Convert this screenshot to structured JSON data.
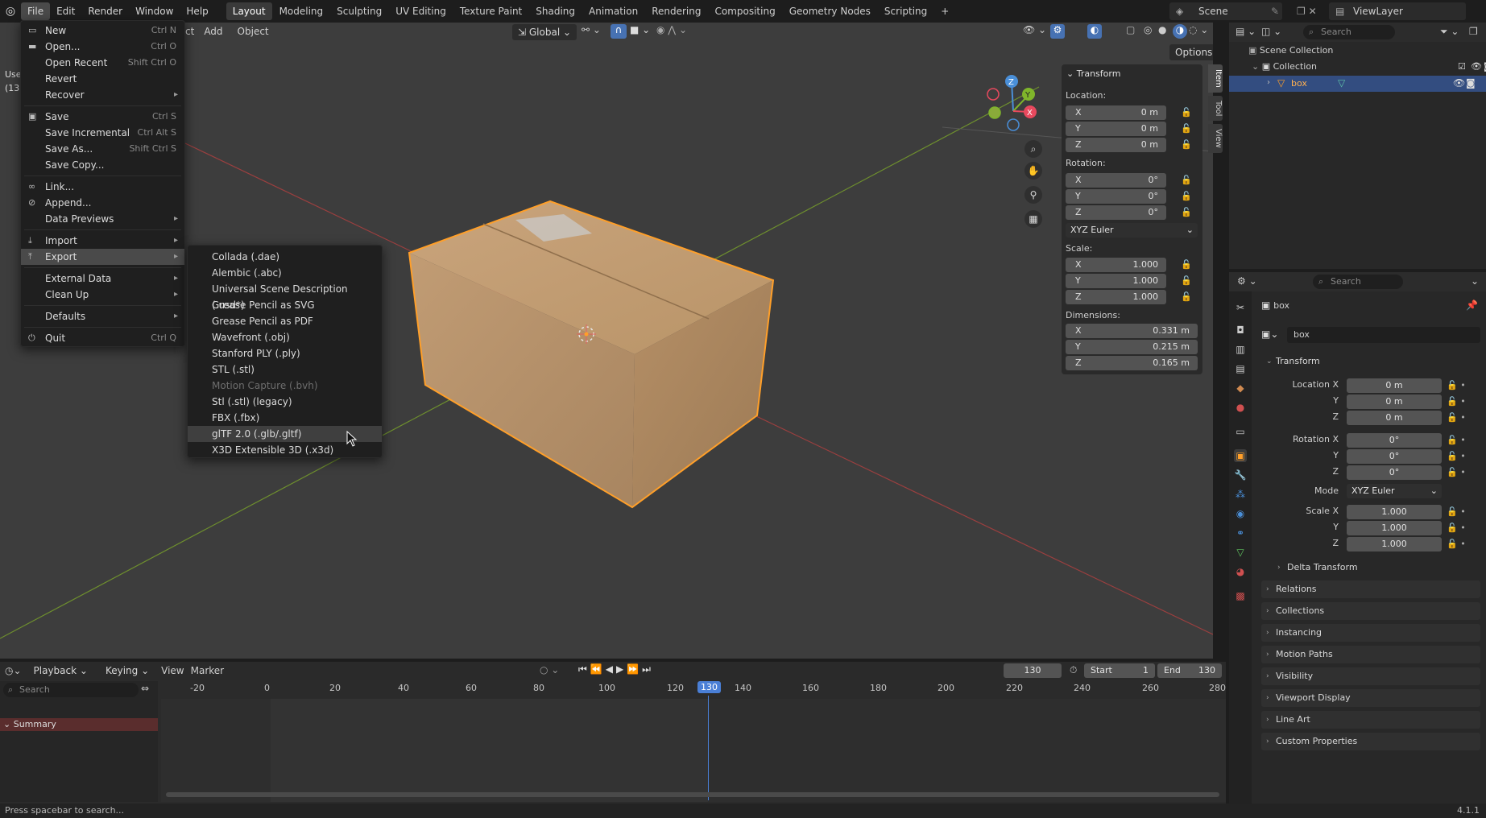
{
  "topbar": {
    "menus": [
      "File",
      "Edit",
      "Render",
      "Window",
      "Help"
    ],
    "workspaces": [
      "Layout",
      "Modeling",
      "Sculpting",
      "UV Editing",
      "Texture Paint",
      "Shading",
      "Animation",
      "Rendering",
      "Compositing",
      "Geometry Nodes",
      "Scripting"
    ],
    "add_tab": "+",
    "scene": "Scene",
    "view_layer": "ViewLayer"
  },
  "viewport_header": {
    "mode_partial": "ct",
    "add": "Add",
    "object": "Object",
    "orientation": "Global",
    "options": "Options",
    "side_text_1": "Use",
    "side_text_2": "(13"
  },
  "file_menu": {
    "items": [
      {
        "label": "New",
        "shortcut": "Ctrl N",
        "arrow": "▸"
      },
      {
        "label": "Open...",
        "shortcut": "Ctrl O"
      },
      {
        "label": "Open Recent",
        "shortcut": "Shift Ctrl O",
        "arrow": "▸"
      },
      {
        "label": "Revert"
      },
      {
        "label": "Recover",
        "arrow": "▸"
      },
      {
        "label": "Save",
        "shortcut": "Ctrl S"
      },
      {
        "label": "Save Incremental",
        "shortcut": "Ctrl Alt S"
      },
      {
        "label": "Save As...",
        "shortcut": "Shift Ctrl S"
      },
      {
        "label": "Save Copy..."
      },
      {
        "label": "Link..."
      },
      {
        "label": "Append..."
      },
      {
        "label": "Data Previews",
        "arrow": "▸"
      },
      {
        "label": "Import",
        "arrow": "▸"
      },
      {
        "label": "Export",
        "arrow": "▸"
      },
      {
        "label": "External Data",
        "arrow": "▸"
      },
      {
        "label": "Clean Up",
        "arrow": "▸"
      },
      {
        "label": "Defaults",
        "arrow": "▸"
      },
      {
        "label": "Quit",
        "shortcut": "Ctrl Q"
      }
    ]
  },
  "export_menu": {
    "items": [
      {
        "label": "Collada (.dae)",
        "state": "normal"
      },
      {
        "label": "Alembic (.abc)",
        "state": "normal"
      },
      {
        "label": "Universal Scene Description (.usd*)",
        "state": "normal"
      },
      {
        "label": "Grease Pencil as SVG",
        "state": "normal"
      },
      {
        "label": "Grease Pencil as PDF",
        "state": "normal"
      },
      {
        "label": "Wavefront (.obj)",
        "state": "normal"
      },
      {
        "label": "Stanford PLY (.ply)",
        "state": "normal"
      },
      {
        "label": "STL (.stl)",
        "state": "normal"
      },
      {
        "label": "Motion Capture (.bvh)",
        "state": "disabled"
      },
      {
        "label": "Stl (.stl) (legacy)",
        "state": "normal"
      },
      {
        "label": "FBX (.fbx)",
        "state": "normal"
      },
      {
        "label": "glTF 2.0 (.glb/.gltf)",
        "state": "highlighted"
      },
      {
        "label": "X3D Extensible 3D (.x3d)",
        "state": "normal"
      }
    ]
  },
  "npanel": {
    "title": "Transform",
    "location_label": "Location:",
    "location": [
      {
        "axis": "X",
        "value": "0 m"
      },
      {
        "axis": "Y",
        "value": "0 m"
      },
      {
        "axis": "Z",
        "value": "0 m"
      }
    ],
    "rotation_label": "Rotation:",
    "rotation": [
      {
        "axis": "X",
        "value": "0°"
      },
      {
        "axis": "Y",
        "value": "0°"
      },
      {
        "axis": "Z",
        "value": "0°"
      }
    ],
    "rotation_mode": "XYZ Euler",
    "scale_label": "Scale:",
    "scale": [
      {
        "axis": "X",
        "value": "1.000"
      },
      {
        "axis": "Y",
        "value": "1.000"
      },
      {
        "axis": "Z",
        "value": "1.000"
      }
    ],
    "dimensions_label": "Dimensions:",
    "dimensions": [
      {
        "axis": "X",
        "value": "0.331 m"
      },
      {
        "axis": "Y",
        "value": "0.215 m"
      },
      {
        "axis": "Z",
        "value": "0.165 m"
      }
    ],
    "tabs": [
      "Item",
      "Tool",
      "View"
    ]
  },
  "gizmo": {
    "x": "X",
    "y": "Y",
    "z": "Z"
  },
  "outliner": {
    "search_placeholder": "Search",
    "scene_collection": "Scene Collection",
    "collection": "Collection",
    "object": "box"
  },
  "properties": {
    "search_placeholder": "Search",
    "object_name": "box",
    "object_field": "box",
    "transform": "Transform",
    "location_x_label": "Location X",
    "y_label": "Y",
    "z_label": "Z",
    "location": [
      "0 m",
      "0 m",
      "0 m"
    ],
    "rotation_x_label": "Rotation X",
    "rotation": [
      "0°",
      "0°",
      "0°"
    ],
    "mode_label": "Mode",
    "mode_value": "XYZ Euler",
    "scale_x_label": "Scale X",
    "scale": [
      "1.000",
      "1.000",
      "1.000"
    ],
    "delta_transform": "Delta Transform",
    "sections": [
      "Relations",
      "Collections",
      "Instancing",
      "Motion Paths",
      "Visibility",
      "Viewport Display",
      "Line Art",
      "Custom Properties"
    ]
  },
  "timeline": {
    "playback": "Playback",
    "keying": "Keying",
    "view": "View",
    "marker": "Marker",
    "current_frame": "130",
    "start_label": "Start",
    "start_value": "1",
    "end_label": "End",
    "end_value": "130",
    "search_placeholder": "Search",
    "summary": "Summary",
    "ticks": [
      "-20",
      "0",
      "20",
      "40",
      "60",
      "80",
      "100",
      "120",
      "130",
      "140",
      "160",
      "180",
      "200",
      "220",
      "240",
      "260",
      "280"
    ]
  },
  "statusbar": {
    "hint": "Press spacebar to search...",
    "version": "4.1.1"
  },
  "colors": {
    "accent": "#4772b3",
    "selection_orange": "#ff9f29",
    "playhead": "#4a7fd6"
  }
}
